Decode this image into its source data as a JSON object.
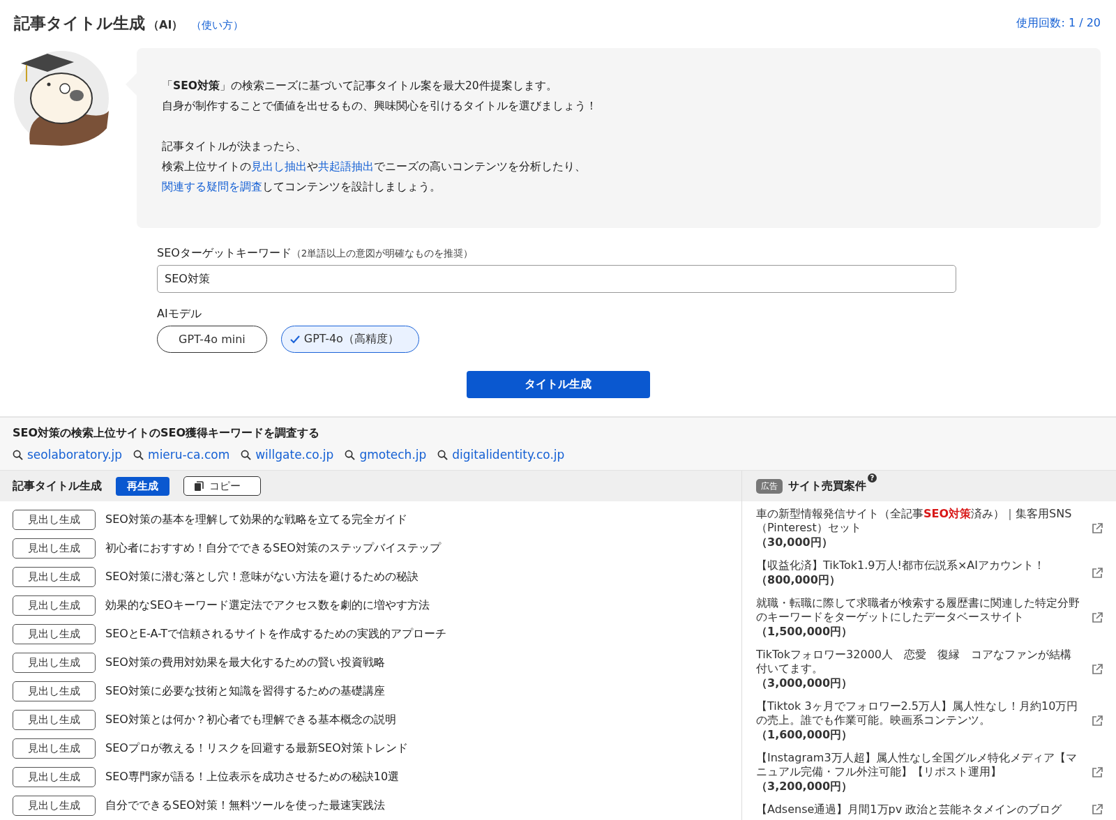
{
  "header": {
    "title": "記事タイトル生成",
    "suffix": "（AI）",
    "help_link": "（使い方）",
    "usage": "使用回数: 1 / 20"
  },
  "intro": {
    "paragraphs": [
      {
        "lines": [
          [
            {
              "kind": "text",
              "text": "「**SEO対策**」の検索ニーズに基づいて記事タイトル案を最大20件提案します。"
            }
          ],
          [
            {
              "kind": "text",
              "text": "自身が制作することで価値を出せるもの、興味関心を引けるタイトルを選びましょう！"
            }
          ]
        ]
      },
      {
        "lines": [
          [
            {
              "kind": "text",
              "text": "記事タイトルが決まったら、"
            }
          ],
          [
            {
              "kind": "text",
              "text": "検索上位サイトの"
            },
            {
              "kind": "link",
              "text": "見出し抽出"
            },
            {
              "kind": "text",
              "text": "や"
            },
            {
              "kind": "link",
              "text": "共起語抽出"
            },
            {
              "kind": "text",
              "text": "でニーズの高いコンテンツを分析したり、"
            }
          ],
          [
            {
              "kind": "link",
              "text": "関連する疑問を調査"
            },
            {
              "kind": "text",
              "text": "してコンテンツを設計しましょう。"
            }
          ]
        ]
      }
    ]
  },
  "form": {
    "keyword_label": "SEOターゲットキーワード",
    "keyword_hint": "（2単語以上の意図が明確なものを推奨）",
    "keyword_value": "SEO対策",
    "model_label": "AIモデル",
    "models": [
      {
        "label": "GPT-4o mini",
        "selected": false
      },
      {
        "label": "GPT-4o（高精度）",
        "selected": true
      }
    ],
    "submit": "タイトル生成"
  },
  "research": {
    "heading": "SEO対策の検索上位サイトのSEO獲得キーワードを調査する",
    "sites": [
      "seolaboratory.jp",
      "mieru-ca.com",
      "willgate.co.jp",
      "gmotech.jp",
      "digitalidentity.co.jp"
    ]
  },
  "titles": {
    "heading": "記事タイトル生成",
    "regenerate": "再生成",
    "copy": "コピー",
    "rows": [
      {
        "action": "見出し生成",
        "title": "SEO対策の基本を理解して効果的な戦略を立てる完全ガイド"
      },
      {
        "action": "見出し生成",
        "title": "初心者におすすめ！自分でできるSEO対策のステップバイステップ"
      },
      {
        "action": "見出し生成",
        "title": "SEO対策に潜む落とし穴！意味がない方法を避けるための秘訣"
      },
      {
        "action": "見出し生成",
        "title": "効果的なSEOキーワード選定法でアクセス数を劇的に増やす方法"
      },
      {
        "action": "見出し生成",
        "title": "SEOとE-A-Tで信頼されるサイトを作成するための実践的アプローチ"
      },
      {
        "action": "見出し生成",
        "title": "SEO対策の費用対効果を最大化するための賢い投資戦略"
      },
      {
        "action": "見出し生成",
        "title": "SEO対策に必要な技術と知識を習得するための基礎講座"
      },
      {
        "action": "見出し生成",
        "title": "SEO対策とは何か？初心者でも理解できる基本概念の説明"
      },
      {
        "action": "見出し生成",
        "title": "SEOプロが教える！リスクを回避する最新SEO対策トレンド"
      },
      {
        "action": "見出し生成",
        "title": "SEO専門家が語る！上位表示を成功させるための秘訣10選"
      },
      {
        "action": "見出し生成",
        "title": "自分でできるSEO対策！無料ツールを使った最速実践法"
      }
    ]
  },
  "ads": {
    "badge": "広告",
    "heading": "サイト売買案件",
    "help": "?",
    "items": [
      {
        "title": "車の新型情報発信サイト（全記事**SEO対策**済み）｜集客用SNS（Pinterest）セット",
        "price": "（30,000円）"
      },
      {
        "title": "【収益化済】TikTok1.9万人!都市伝説系×AIアカウント！",
        "price": "（800,000円）"
      },
      {
        "title": "就職・転職に際して求職者が検索する履歴書に関連した特定分野のキーワードをターゲットにしたデータベースサイト",
        "price": "（1,500,000円）"
      },
      {
        "title": "TikTokフォロワー32000人　恋愛　復縁　コアなファンが結構付いてます。",
        "price": "（3,000,000円）"
      },
      {
        "title": "【Tiktok 3ヶ月でフォロワー2.5万人】属人性なし！月約10万円の売上。誰でも作業可能。映画系コンテンツ。",
        "price": "（1,600,000円）"
      },
      {
        "title": "【Instagram3万人超】属人性なし全国グルメ特化メディア【マニュアル完備・フル外注可能】【リポスト運用】",
        "price": "（3,200,000円）"
      },
      {
        "title": "【Adsense通過】月間1万pv 政治と芸能ネタメインのブログ"
      }
    ]
  }
}
